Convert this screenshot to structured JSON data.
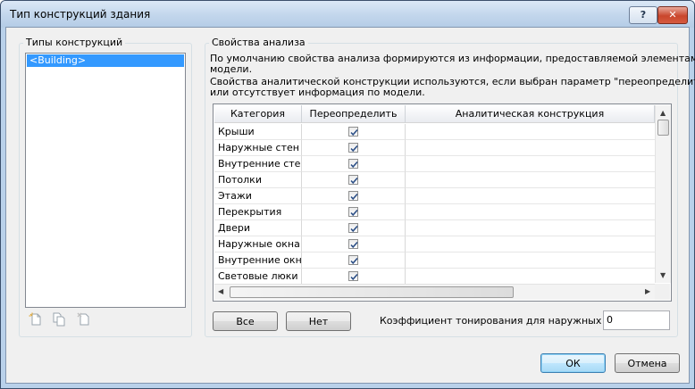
{
  "window": {
    "title": "Тип конструкций здания",
    "help_label": "?",
    "close_label": "✕"
  },
  "types_panel": {
    "title": "Типы конструкций",
    "items": [
      "<Building>"
    ],
    "icons": [
      "new-type-icon",
      "copy-type-icon",
      "delete-type-icon"
    ]
  },
  "analysis": {
    "title": "Свойства анализа",
    "desc": [
      "По умолчанию свойства анализа формируются из информации, предоставляемой элементами",
      "модели.",
      "Свойства аналитической конструкции используются, если выбран параметр \"переопределить\"",
      "или отсутствует информация по модели."
    ],
    "columns": [
      "Категория",
      "Переопределить",
      "Аналитическая конструкция"
    ],
    "rows": [
      {
        "category": "Крыши",
        "override": true,
        "construction": ""
      },
      {
        "category": "Наружные стен",
        "override": true,
        "construction": ""
      },
      {
        "category": "Внутренние стен",
        "override": true,
        "construction": ""
      },
      {
        "category": "Потолки",
        "override": true,
        "construction": ""
      },
      {
        "category": "Этажи",
        "override": true,
        "construction": ""
      },
      {
        "category": "Перекрытия",
        "override": true,
        "construction": ""
      },
      {
        "category": "Двери",
        "override": true,
        "construction": ""
      },
      {
        "category": "Наружные окна",
        "override": true,
        "construction": ""
      },
      {
        "category": "Внутренние окн",
        "override": true,
        "construction": ""
      },
      {
        "category": "Световые люки",
        "override": true,
        "construction": ""
      }
    ],
    "all_label": "Все",
    "none_label": "Нет",
    "shading_label": "Коэффициент тонирования для наружных окон:",
    "shading_value": "0"
  },
  "footer": {
    "ok_label": "ОК",
    "cancel_label": "Отмена"
  },
  "colors": {
    "title_bar": "#c2d6ec",
    "selection": "#3399ff",
    "close_button": "#c9462c"
  }
}
